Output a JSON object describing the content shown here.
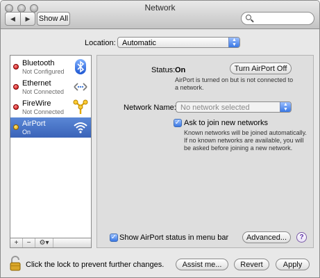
{
  "window": {
    "title": "Network"
  },
  "toolbar": {
    "back_glyph": "◀",
    "forward_glyph": "▶",
    "show_all_label": "Show All",
    "search_placeholder": ""
  },
  "location": {
    "label": "Location:",
    "value": "Automatic"
  },
  "services": [
    {
      "name": "Bluetooth",
      "status": "Not Configured",
      "status_color": "red",
      "icon": "bluetooth-icon",
      "selected": false
    },
    {
      "name": "Ethernet",
      "status": "Not Connected",
      "status_color": "red",
      "icon": "ethernet-icon",
      "selected": false
    },
    {
      "name": "FireWire",
      "status": "Not Connected",
      "status_color": "red",
      "icon": "firewire-icon",
      "selected": false
    },
    {
      "name": "AirPort",
      "status": "On",
      "status_color": "yellow",
      "icon": "wifi-icon",
      "selected": true
    }
  ],
  "sidebar_controls": {
    "add": "+",
    "remove": "−",
    "gear": "⚙▾"
  },
  "panel": {
    "status_label": "Status:",
    "status_value": "On",
    "turn_off_button": "Turn AirPort Off",
    "status_desc_line1": "AirPort is turned on but is not connected to",
    "status_desc_line2": "a network.",
    "network_name_label": "Network Name:",
    "network_name_placeholder": "No network selected",
    "ask_to_join_label": "Ask to join new networks",
    "ask_to_join_checked": true,
    "ask_desc_line1": "Known networks will be joined automatically.",
    "ask_desc_line2": "If no known networks are available, you will",
    "ask_desc_line3": "be asked before joining a new network.",
    "show_status_label": "Show AirPort status in menu bar",
    "show_status_checked": true,
    "advanced_button": "Advanced...",
    "help_glyph": "?"
  },
  "footer": {
    "lock_text": "Click the lock to prevent further changes.",
    "assist_button": "Assist me...",
    "revert_button": "Revert",
    "apply_button": "Apply"
  },
  "colors": {
    "selection": "#3a63b8",
    "status_red": "#c40000",
    "status_yellow": "#d79b00",
    "accent_blue": "#3877e4"
  }
}
